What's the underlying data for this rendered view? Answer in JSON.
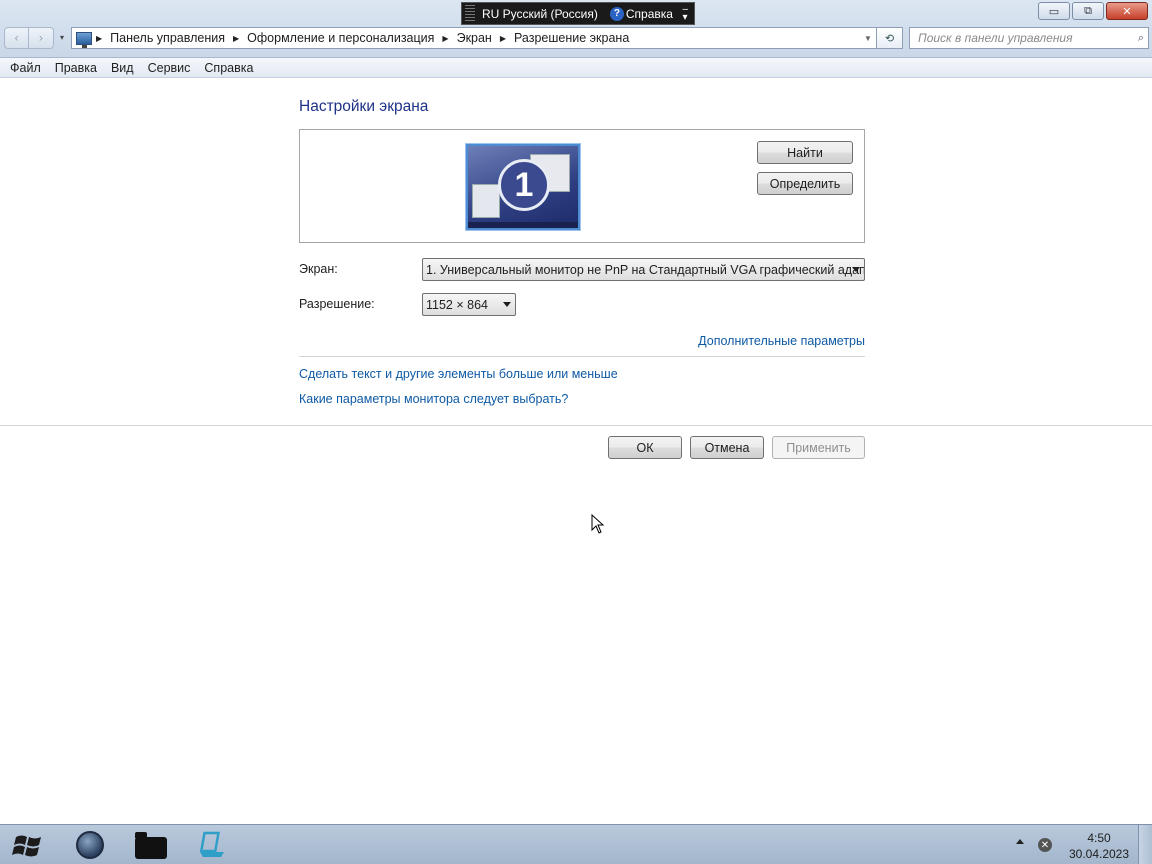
{
  "langbar": {
    "language": "RU Русский (Россия)",
    "help": "Справка"
  },
  "window_buttons": {
    "minimize": "▭",
    "restore": "⧉",
    "close": "✕"
  },
  "address": {
    "crumbs": [
      "Панель управления",
      "Оформление и персонализация",
      "Экран",
      "Разрешение экрана"
    ]
  },
  "search": {
    "placeholder": "Поиск в панели управления"
  },
  "menu": [
    "Файл",
    "Правка",
    "Вид",
    "Сервис",
    "Справка"
  ],
  "page": {
    "title": "Настройки экрана",
    "monitor_number": "1",
    "buttons": {
      "detect": "Найти",
      "identify": "Определить"
    },
    "screen_label": "Экран:",
    "screen_value": "1. Универсальный монитор не PnP на Стандартный VGA графический адапт",
    "resolution_label": "Разрешение:",
    "resolution_value": "1152 × 864",
    "advanced_link": "Дополнительные параметры",
    "links": [
      "Сделать текст и другие элементы больше или меньше",
      "Какие параметры монитора следует выбрать?"
    ],
    "dialog_buttons": {
      "ok": "ОК",
      "cancel": "Отмена",
      "apply": "Применить"
    }
  },
  "taskbar": {
    "icons": [
      "windows-start-icon",
      "globe-icon",
      "folder-icon",
      "network-icon"
    ],
    "time": "4:50",
    "date": "30.04.2023"
  }
}
